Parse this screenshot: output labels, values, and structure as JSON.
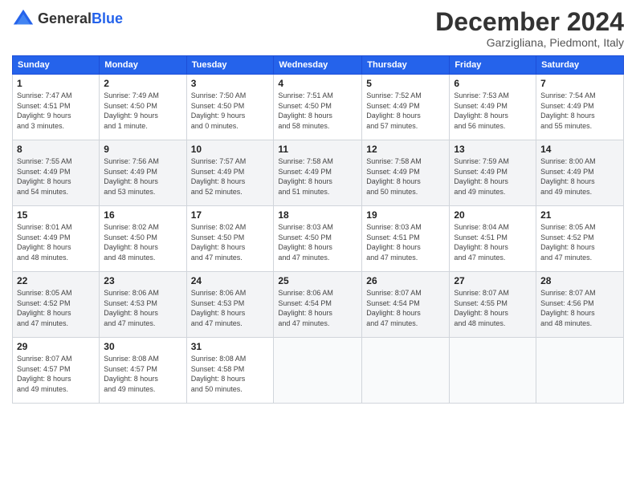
{
  "header": {
    "logo_general": "General",
    "logo_blue": "Blue",
    "title": "December 2024",
    "subtitle": "Garzigliana, Piedmont, Italy"
  },
  "columns": [
    "Sunday",
    "Monday",
    "Tuesday",
    "Wednesday",
    "Thursday",
    "Friday",
    "Saturday"
  ],
  "weeks": [
    [
      {
        "day": "1",
        "info": "Sunrise: 7:47 AM\nSunset: 4:51 PM\nDaylight: 9 hours\nand 3 minutes."
      },
      {
        "day": "2",
        "info": "Sunrise: 7:49 AM\nSunset: 4:50 PM\nDaylight: 9 hours\nand 1 minute."
      },
      {
        "day": "3",
        "info": "Sunrise: 7:50 AM\nSunset: 4:50 PM\nDaylight: 9 hours\nand 0 minutes."
      },
      {
        "day": "4",
        "info": "Sunrise: 7:51 AM\nSunset: 4:50 PM\nDaylight: 8 hours\nand 58 minutes."
      },
      {
        "day": "5",
        "info": "Sunrise: 7:52 AM\nSunset: 4:49 PM\nDaylight: 8 hours\nand 57 minutes."
      },
      {
        "day": "6",
        "info": "Sunrise: 7:53 AM\nSunset: 4:49 PM\nDaylight: 8 hours\nand 56 minutes."
      },
      {
        "day": "7",
        "info": "Sunrise: 7:54 AM\nSunset: 4:49 PM\nDaylight: 8 hours\nand 55 minutes."
      }
    ],
    [
      {
        "day": "8",
        "info": "Sunrise: 7:55 AM\nSunset: 4:49 PM\nDaylight: 8 hours\nand 54 minutes."
      },
      {
        "day": "9",
        "info": "Sunrise: 7:56 AM\nSunset: 4:49 PM\nDaylight: 8 hours\nand 53 minutes."
      },
      {
        "day": "10",
        "info": "Sunrise: 7:57 AM\nSunset: 4:49 PM\nDaylight: 8 hours\nand 52 minutes."
      },
      {
        "day": "11",
        "info": "Sunrise: 7:58 AM\nSunset: 4:49 PM\nDaylight: 8 hours\nand 51 minutes."
      },
      {
        "day": "12",
        "info": "Sunrise: 7:58 AM\nSunset: 4:49 PM\nDaylight: 8 hours\nand 50 minutes."
      },
      {
        "day": "13",
        "info": "Sunrise: 7:59 AM\nSunset: 4:49 PM\nDaylight: 8 hours\nand 49 minutes."
      },
      {
        "day": "14",
        "info": "Sunrise: 8:00 AM\nSunset: 4:49 PM\nDaylight: 8 hours\nand 49 minutes."
      }
    ],
    [
      {
        "day": "15",
        "info": "Sunrise: 8:01 AM\nSunset: 4:49 PM\nDaylight: 8 hours\nand 48 minutes."
      },
      {
        "day": "16",
        "info": "Sunrise: 8:02 AM\nSunset: 4:50 PM\nDaylight: 8 hours\nand 48 minutes."
      },
      {
        "day": "17",
        "info": "Sunrise: 8:02 AM\nSunset: 4:50 PM\nDaylight: 8 hours\nand 47 minutes."
      },
      {
        "day": "18",
        "info": "Sunrise: 8:03 AM\nSunset: 4:50 PM\nDaylight: 8 hours\nand 47 minutes."
      },
      {
        "day": "19",
        "info": "Sunrise: 8:03 AM\nSunset: 4:51 PM\nDaylight: 8 hours\nand 47 minutes."
      },
      {
        "day": "20",
        "info": "Sunrise: 8:04 AM\nSunset: 4:51 PM\nDaylight: 8 hours\nand 47 minutes."
      },
      {
        "day": "21",
        "info": "Sunrise: 8:05 AM\nSunset: 4:52 PM\nDaylight: 8 hours\nand 47 minutes."
      }
    ],
    [
      {
        "day": "22",
        "info": "Sunrise: 8:05 AM\nSunset: 4:52 PM\nDaylight: 8 hours\nand 47 minutes."
      },
      {
        "day": "23",
        "info": "Sunrise: 8:06 AM\nSunset: 4:53 PM\nDaylight: 8 hours\nand 47 minutes."
      },
      {
        "day": "24",
        "info": "Sunrise: 8:06 AM\nSunset: 4:53 PM\nDaylight: 8 hours\nand 47 minutes."
      },
      {
        "day": "25",
        "info": "Sunrise: 8:06 AM\nSunset: 4:54 PM\nDaylight: 8 hours\nand 47 minutes."
      },
      {
        "day": "26",
        "info": "Sunrise: 8:07 AM\nSunset: 4:54 PM\nDaylight: 8 hours\nand 47 minutes."
      },
      {
        "day": "27",
        "info": "Sunrise: 8:07 AM\nSunset: 4:55 PM\nDaylight: 8 hours\nand 48 minutes."
      },
      {
        "day": "28",
        "info": "Sunrise: 8:07 AM\nSunset: 4:56 PM\nDaylight: 8 hours\nand 48 minutes."
      }
    ],
    [
      {
        "day": "29",
        "info": "Sunrise: 8:07 AM\nSunset: 4:57 PM\nDaylight: 8 hours\nand 49 minutes."
      },
      {
        "day": "30",
        "info": "Sunrise: 8:08 AM\nSunset: 4:57 PM\nDaylight: 8 hours\nand 49 minutes."
      },
      {
        "day": "31",
        "info": "Sunrise: 8:08 AM\nSunset: 4:58 PM\nDaylight: 8 hours\nand 50 minutes."
      },
      {
        "day": "",
        "info": ""
      },
      {
        "day": "",
        "info": ""
      },
      {
        "day": "",
        "info": ""
      },
      {
        "day": "",
        "info": ""
      }
    ]
  ]
}
